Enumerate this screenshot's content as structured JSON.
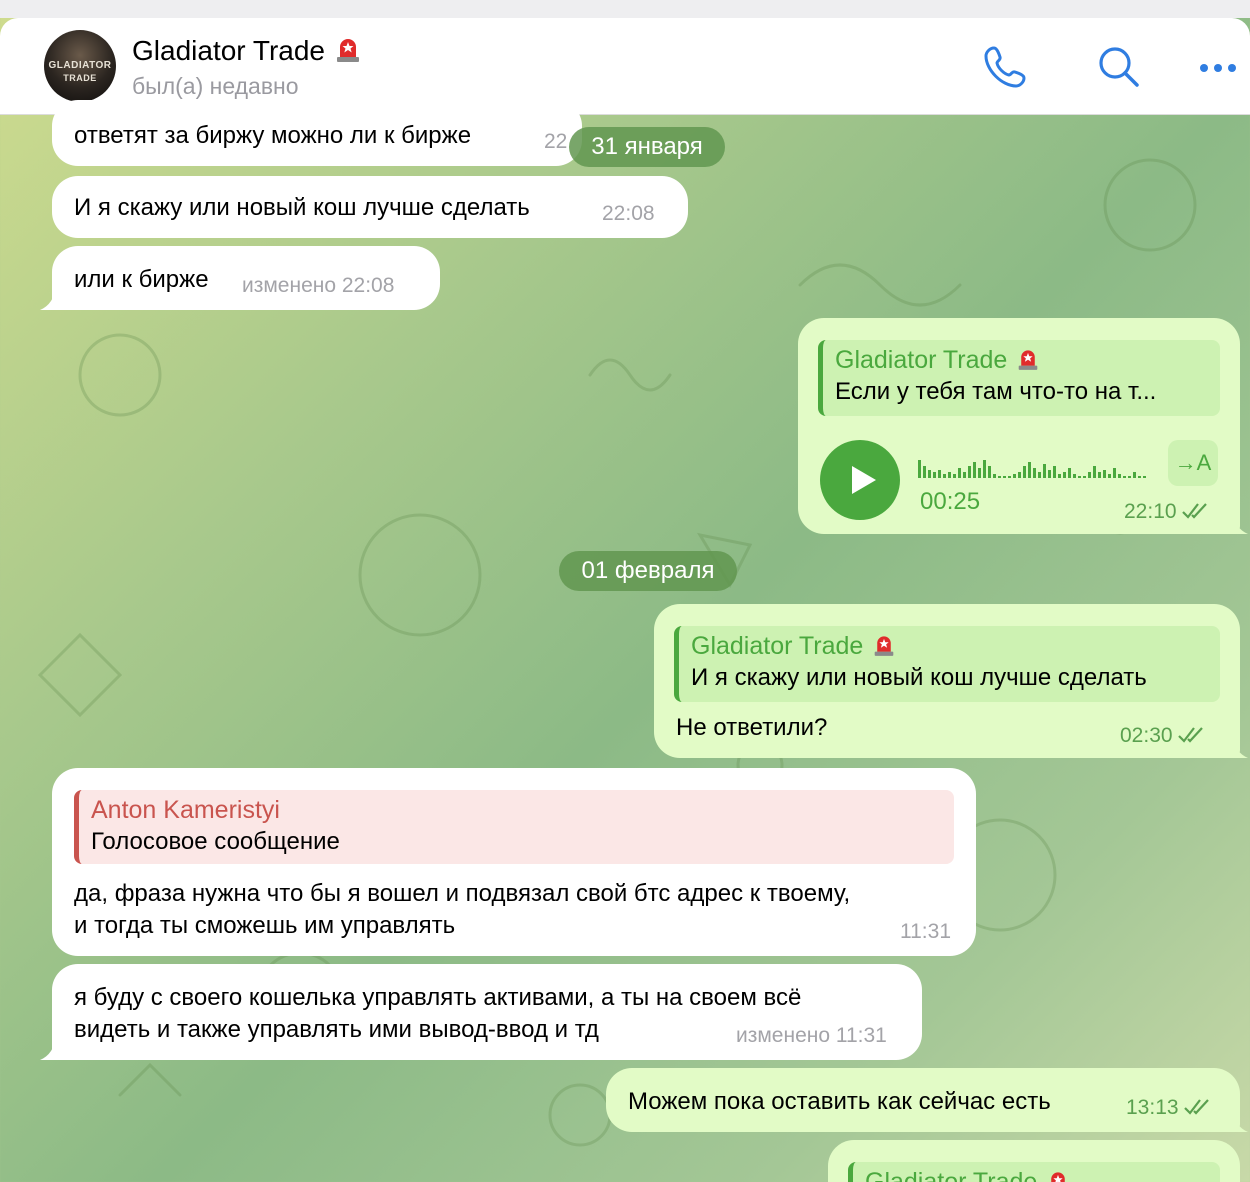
{
  "chat": {
    "title": "Gladiator Trade",
    "status": "был(а) недавно",
    "avatar_text_line1": "GLADIATOR",
    "avatar_text_line2": "TRADE"
  },
  "header_icons": [
    "phone-icon",
    "search-icon",
    "more-icon"
  ],
  "date_pills": [
    "31 января",
    "01 февраля"
  ],
  "messages": [
    {
      "dir": "in",
      "text": "ответят за биржу можно ли к бирже",
      "time": "22"
    },
    {
      "dir": "in",
      "text": "И я скажу или новый кош лучше сделать",
      "time": "22:08"
    },
    {
      "dir": "in",
      "text": "или к бирже",
      "time": "изменено 22:08"
    },
    {
      "dir": "out",
      "reply_name": "Gladiator Trade",
      "reply_text": "Если у тебя там что-то на т...",
      "voice_duration": "00:25",
      "transcribe_label": "→A",
      "time": "22:10"
    },
    {
      "dir": "out",
      "reply_name": "Gladiator Trade",
      "reply_text": "И я скажу или новый кош лучше сделать",
      "text": "Не ответили?",
      "time": "02:30"
    },
    {
      "dir": "in",
      "reply_name": "Anton Kameristyi",
      "reply_text": "Голосовое сообщение",
      "text_line1": "да, фраза нужна что бы я вошел и подвязал свой бтс адрес к твоему,",
      "text_line2": "и тогда ты сможешь им управлять",
      "time": "11:31"
    },
    {
      "dir": "in",
      "text_line1": "я буду с своего кошелька управлять активами, а ты на своем всё",
      "text_line2": "видеть и также управлять ими вывод-ввод и тд",
      "time": "изменено 11:31"
    },
    {
      "dir": "out",
      "text": "Можем пока оставить как сейчас есть",
      "time": "13:13"
    },
    {
      "dir": "out",
      "reply_name": "Gladiator Trade",
      "partial": true
    }
  ],
  "colors": {
    "outgoing_bubble": "#e2fbc6",
    "incoming_bubble": "#ffffff",
    "accent_green": "#4aa83e",
    "reply_red": "#c9544e",
    "header_icon_blue": "#2f7de1"
  }
}
